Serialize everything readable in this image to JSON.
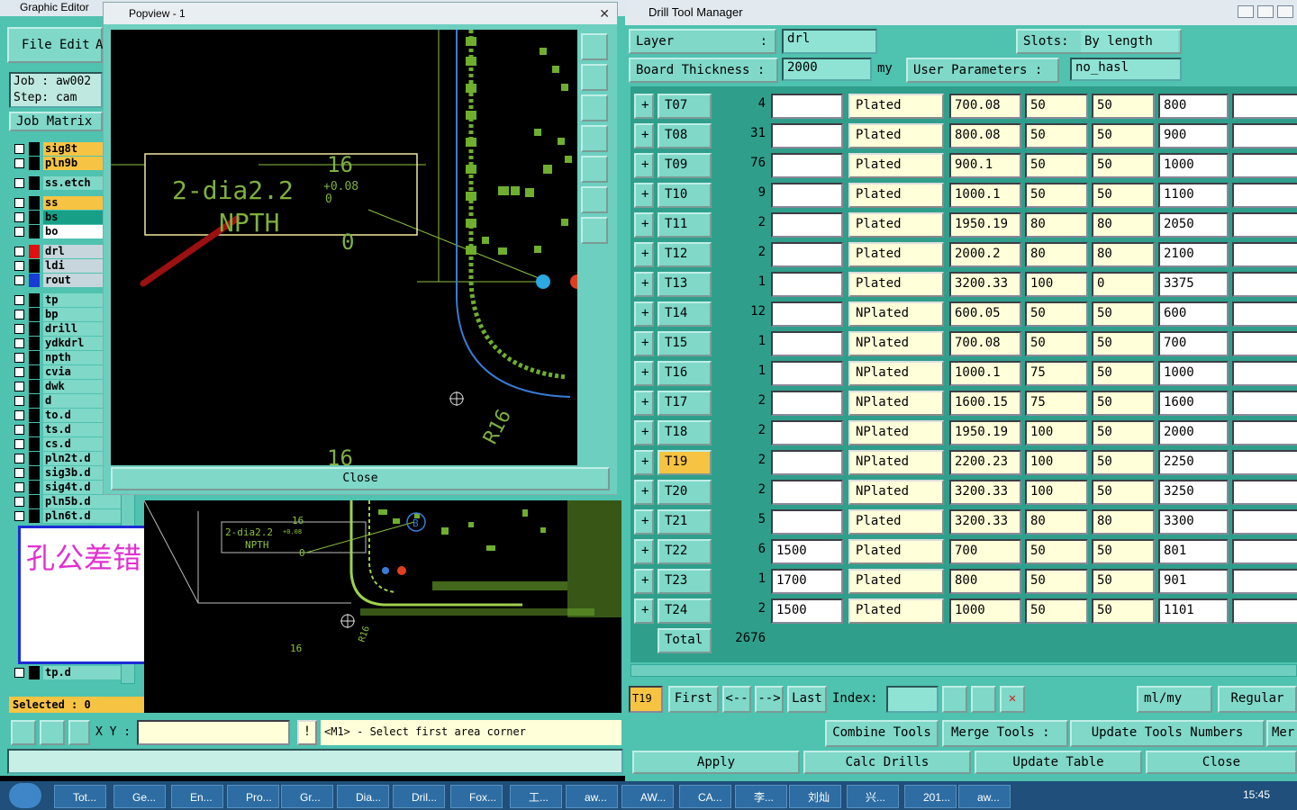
{
  "graphic_editor": {
    "title": "Graphic Editor",
    "menu": [
      "File",
      "Edit",
      "A"
    ],
    "job": "Job : aw002",
    "step": "Step: cam",
    "job_matrix": "Job Matrix",
    "layers": [
      {
        "name": "sig8t",
        "color": "#f6c343"
      },
      {
        "name": "pln9b",
        "color": "#f6c343"
      },
      {
        "name": "ss.etch",
        "color": "#7fd8c8"
      },
      {
        "name": "ss",
        "color": "#f6c343"
      },
      {
        "name": "bs",
        "color": "#17a087"
      },
      {
        "name": "bo",
        "color": "#ffffff"
      },
      {
        "name": "drl",
        "color": "#c6d6dc"
      },
      {
        "name": "ldi",
        "color": "#c6d6dc"
      },
      {
        "name": "rout",
        "color": "#c6d6dc"
      },
      {
        "name": "tp",
        "color": "#7fd8c8"
      },
      {
        "name": "bp",
        "color": "#7fd8c8"
      },
      {
        "name": "drill",
        "color": "#7fd8c8"
      },
      {
        "name": "ydkdrl",
        "color": "#7fd8c8"
      },
      {
        "name": "npth",
        "color": "#7fd8c8"
      },
      {
        "name": "cvia",
        "color": "#7fd8c8"
      },
      {
        "name": "dwk",
        "color": "#7fd8c8"
      },
      {
        "name": "d",
        "color": "#7fd8c8"
      },
      {
        "name": "to.d",
        "color": "#7fd8c8"
      },
      {
        "name": "ts.d",
        "color": "#7fd8c8"
      },
      {
        "name": "cs.d",
        "color": "#7fd8c8"
      },
      {
        "name": "pln2t.d",
        "color": "#7fd8c8"
      },
      {
        "name": "sig3b.d",
        "color": "#7fd8c8"
      },
      {
        "name": "sig4t.d",
        "color": "#7fd8c8"
      },
      {
        "name": "pln5b.d",
        "color": "#7fd8c8"
      },
      {
        "name": "pln6t.d",
        "color": "#7fd8c8"
      }
    ],
    "last_layer": "tp.d",
    "note_text": "孔公差错",
    "selected": "Selected : 0",
    "xy_label": "X Y :",
    "status_msg": "<M1> - Select first area corner",
    "popview": {
      "title": "Popview - 1",
      "close_label": "Close",
      "annotation_main": "2-dia2.2",
      "annotation_tol_plus": "+0.08",
      "annotation_tol_zero": "0",
      "annotation_npth": "NPTH",
      "dim_16": "16",
      "dim_0": "0",
      "r16": "R16"
    },
    "mini_labels": {
      "main": "2-dia2.2",
      "tol": "+0.08",
      "npth": "NPTH",
      "dim16": "16",
      "dim0": "0",
      "r16": "R16",
      "b": "B"
    }
  },
  "drill_tool_manager": {
    "title": "Drill Tool Manager",
    "layer_label": "Layer",
    "layer_value": "drl",
    "slots_label": "Slots:",
    "slots_value": "By length",
    "board_thickness_label": "Board Thickness :",
    "board_thickness_value": "2000",
    "unit": "my",
    "user_params_label": "User Parameters :",
    "user_params_value": "no_hasl",
    "rows": [
      {
        "tool": "T07",
        "count": "4",
        "size": "",
        "type": "Plated",
        "finish": "700.08",
        "tp": "50",
        "tm": "50",
        "drill": "800"
      },
      {
        "tool": "T08",
        "count": "31",
        "size": "",
        "type": "Plated",
        "finish": "800.08",
        "tp": "50",
        "tm": "50",
        "drill": "900"
      },
      {
        "tool": "T09",
        "count": "76",
        "size": "",
        "type": "Plated",
        "finish": "900.1",
        "tp": "50",
        "tm": "50",
        "drill": "1000"
      },
      {
        "tool": "T10",
        "count": "9",
        "size": "",
        "type": "Plated",
        "finish": "1000.1",
        "tp": "50",
        "tm": "50",
        "drill": "1100"
      },
      {
        "tool": "T11",
        "count": "2",
        "size": "",
        "type": "Plated",
        "finish": "1950.19",
        "tp": "80",
        "tm": "80",
        "drill": "2050"
      },
      {
        "tool": "T12",
        "count": "2",
        "size": "",
        "type": "Plated",
        "finish": "2000.2",
        "tp": "80",
        "tm": "80",
        "drill": "2100"
      },
      {
        "tool": "T13",
        "count": "1",
        "size": "",
        "type": "Plated",
        "finish": "3200.33",
        "tp": "100",
        "tm": "0",
        "drill": "3375"
      },
      {
        "tool": "T14",
        "count": "12",
        "size": "",
        "type": "NPlated",
        "finish": "600.05",
        "tp": "50",
        "tm": "50",
        "drill": "600"
      },
      {
        "tool": "T15",
        "count": "1",
        "size": "",
        "type": "NPlated",
        "finish": "700.08",
        "tp": "50",
        "tm": "50",
        "drill": "700"
      },
      {
        "tool": "T16",
        "count": "1",
        "size": "",
        "type": "NPlated",
        "finish": "1000.1",
        "tp": "75",
        "tm": "50",
        "drill": "1000"
      },
      {
        "tool": "T17",
        "count": "2",
        "size": "",
        "type": "NPlated",
        "finish": "1600.15",
        "tp": "75",
        "tm": "50",
        "drill": "1600"
      },
      {
        "tool": "T18",
        "count": "2",
        "size": "",
        "type": "NPlated",
        "finish": "1950.19",
        "tp": "100",
        "tm": "50",
        "drill": "2000"
      },
      {
        "tool": "T19",
        "count": "2",
        "size": "",
        "type": "NPlated",
        "finish": "2200.23",
        "tp": "100",
        "tm": "50",
        "drill": "2250"
      },
      {
        "tool": "T20",
        "count": "2",
        "size": "",
        "type": "NPlated",
        "finish": "3200.33",
        "tp": "100",
        "tm": "50",
        "drill": "3250"
      },
      {
        "tool": "T21",
        "count": "5",
        "size": "",
        "type": "Plated",
        "finish": "3200.33",
        "tp": "80",
        "tm": "80",
        "drill": "3300"
      },
      {
        "tool": "T22",
        "count": "6",
        "size": "1500",
        "type": "Plated",
        "finish": "700",
        "tp": "50",
        "tm": "50",
        "drill": "801"
      },
      {
        "tool": "T23",
        "count": "1",
        "size": "1700",
        "type": "Plated",
        "finish": "800",
        "tp": "50",
        "tm": "50",
        "drill": "901"
      },
      {
        "tool": "T24",
        "count": "2",
        "size": "1500",
        "type": "Plated",
        "finish": "1000",
        "tp": "50",
        "tm": "50",
        "drill": "1101"
      }
    ],
    "selected_tool": "T19",
    "total_label": "Total",
    "total_value": "2676",
    "nav": {
      "current": "T19",
      "first": "First",
      "prev": "<--",
      "next": "-->",
      "last": "Last",
      "index": "Index:"
    },
    "units_value": "ml/my",
    "mode_value": "Regular",
    "combine": "Combine Tools",
    "merge": "Merge Tools :",
    "update_numbers": "Update Tools Numbers",
    "merge_cut": "Mer",
    "apply": "Apply",
    "calc": "Calc Drills",
    "update_table": "Update Table",
    "close": "Close"
  },
  "taskbar": {
    "items": [
      "Tot...",
      "Ge...",
      "En...",
      "Pro...",
      "Gr...",
      "Dia...",
      "Dril...",
      "Fox...",
      "工...",
      "aw...",
      "AW...",
      "CA...",
      "李...",
      "刘灿",
      "兴...",
      "201...",
      "aw..."
    ],
    "time": "15:45"
  }
}
